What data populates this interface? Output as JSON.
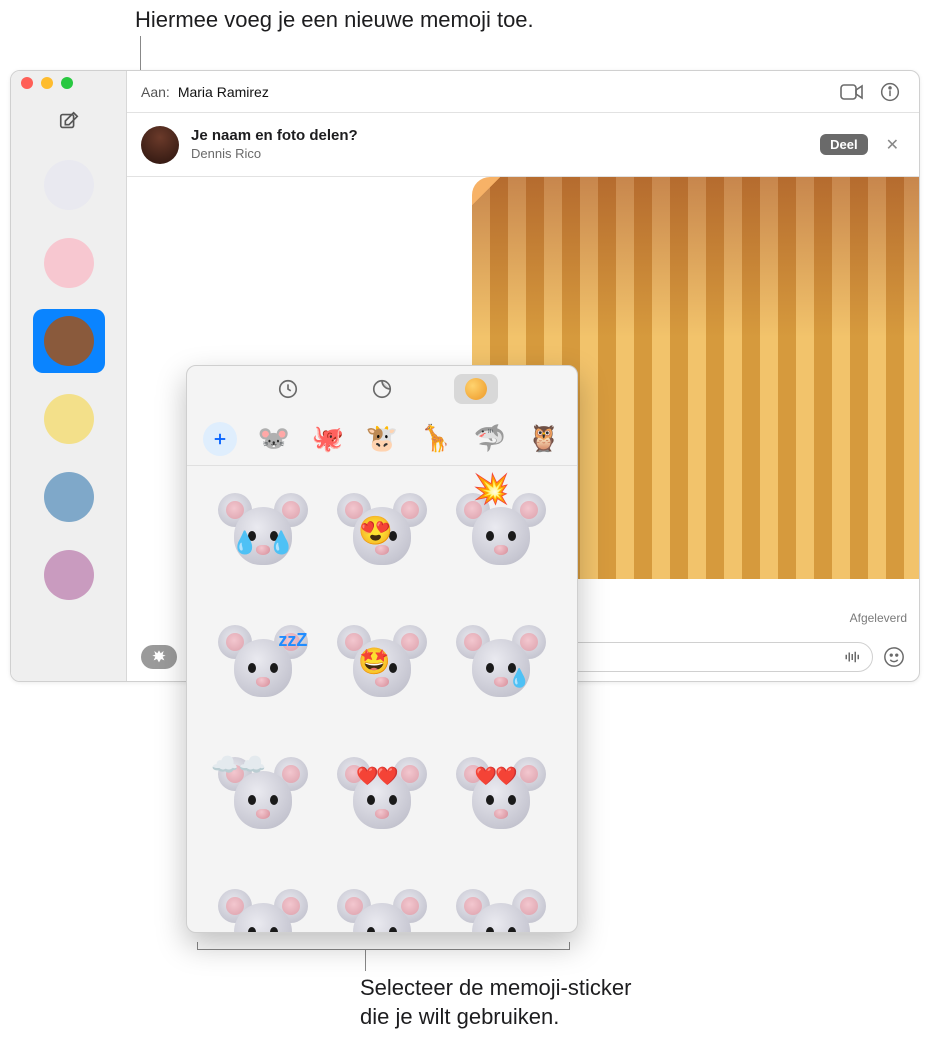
{
  "callouts": {
    "top": "Hiermee voeg je een nieuwe memoji toe.",
    "bottom": "Selecteer de memoji-sticker\ndie je wilt gebruiken."
  },
  "header": {
    "to_label": "Aan:",
    "recipient": "Maria Ramirez"
  },
  "banner": {
    "title": "Je naam en foto delen?",
    "subtitle": "Dennis Rico",
    "share_button": "Deel"
  },
  "thread": {
    "delivered_label": "Afgeleverd"
  },
  "compose": {
    "placeholder": ""
  },
  "sidebar": {
    "conversations": [
      {
        "avatar_bg": "#e9e9f0"
      },
      {
        "avatar_bg": "#f7c7d0"
      },
      {
        "avatar_bg": "#8a5a3c",
        "selected": true
      },
      {
        "avatar_bg": "#f3e08a"
      },
      {
        "avatar_bg": "#7fa8c9"
      },
      {
        "avatar_bg": "#c99bbf"
      }
    ]
  },
  "popover": {
    "tabs": [
      {
        "name": "recents",
        "icon": "clock"
      },
      {
        "name": "stickers",
        "icon": "moon"
      },
      {
        "name": "memoji",
        "icon": "face",
        "active": true
      }
    ],
    "characters": [
      {
        "name": "add",
        "glyph": "+"
      },
      {
        "name": "mouse",
        "glyph": "🐭"
      },
      {
        "name": "octopus",
        "glyph": "🐙"
      },
      {
        "name": "cow",
        "glyph": "🐮"
      },
      {
        "name": "giraffe",
        "glyph": "🦒"
      },
      {
        "name": "shark",
        "glyph": "🦈"
      },
      {
        "name": "owl",
        "glyph": "🦉"
      }
    ],
    "stickers": [
      {
        "name": "mouse-joy-tears",
        "overlays": [
          "tear-l",
          "tear-r"
        ]
      },
      {
        "name": "mouse-heart-eyes",
        "overlays": [
          "hearts"
        ]
      },
      {
        "name": "mouse-mind-blown",
        "overlays": [
          "boom"
        ]
      },
      {
        "name": "mouse-sleeping",
        "overlays": [
          "zzz"
        ]
      },
      {
        "name": "mouse-starstruck",
        "overlays": [
          "stars"
        ]
      },
      {
        "name": "mouse-single-tear",
        "overlays": [
          "drop"
        ]
      },
      {
        "name": "mouse-in-clouds",
        "overlays": [
          "clouds"
        ]
      },
      {
        "name": "mouse-blowing-kiss",
        "overlays": [
          "hearts2"
        ]
      },
      {
        "name": "mouse-loving-cheeks",
        "overlays": [
          "hearts2"
        ]
      },
      {
        "name": "mouse-pleading",
        "overlays": []
      },
      {
        "name": "mouse-angry",
        "overlays": []
      },
      {
        "name": "mouse-cold-sweat",
        "overlays": [
          "sweat"
        ]
      }
    ]
  },
  "overlay_glyphs": {
    "tear-l": "💧",
    "tear-r": "💧",
    "hearts": "😍",
    "boom": "💥",
    "zzz": "zzZ",
    "stars": "🤩",
    "drop": "💧",
    "clouds": "☁️☁️",
    "hearts2": "❤️❤️",
    "sweat": "💧"
  }
}
